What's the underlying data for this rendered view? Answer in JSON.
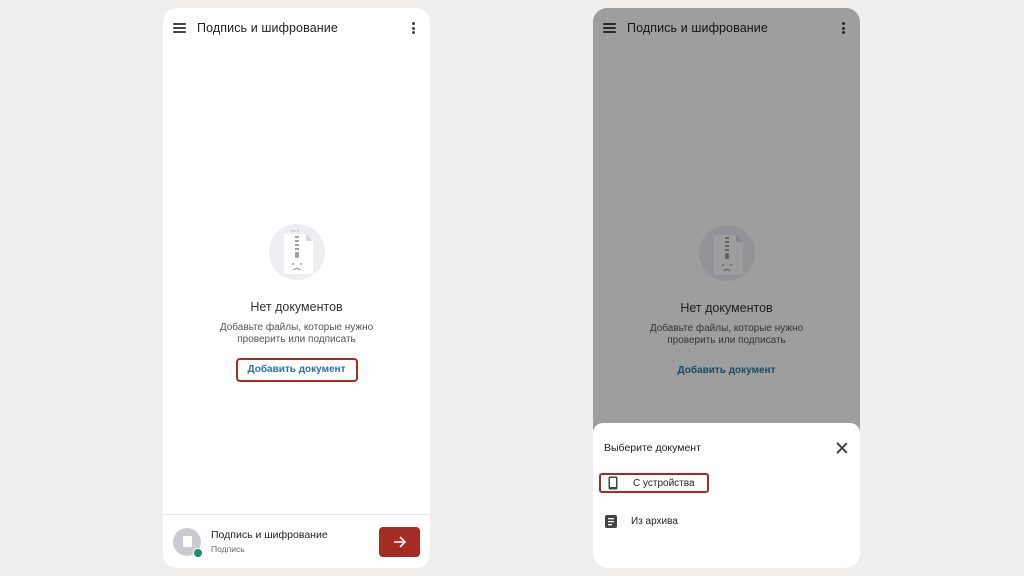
{
  "left": {
    "header": {
      "title": "Подпись и шифрование"
    },
    "empty_state": {
      "title": "Нет документов",
      "subtitle_line1": "Добавьте файлы, которые нужно",
      "subtitle_line2": "проверить или подписать",
      "add_link": "Добавить документ"
    },
    "bottom_card": {
      "title": "Подпись и шифрование",
      "subtitle": "Подпись"
    }
  },
  "right": {
    "header": {
      "title": "Подпись и шифрование"
    },
    "empty_state": {
      "title": "Нет документов",
      "subtitle_line1": "Добавьте файлы, которые нужно",
      "subtitle_line2": "проверить или подписать",
      "add_link": "Добавить документ"
    },
    "sheet": {
      "title": "Выберите документ",
      "items": [
        {
          "label": "С устройства",
          "icon": "phone-icon"
        },
        {
          "label": "Из архива",
          "icon": "archive-icon"
        }
      ]
    }
  },
  "colors": {
    "accent": "#a72b25",
    "link": "#2b73a0",
    "status": "#1f8a72"
  }
}
